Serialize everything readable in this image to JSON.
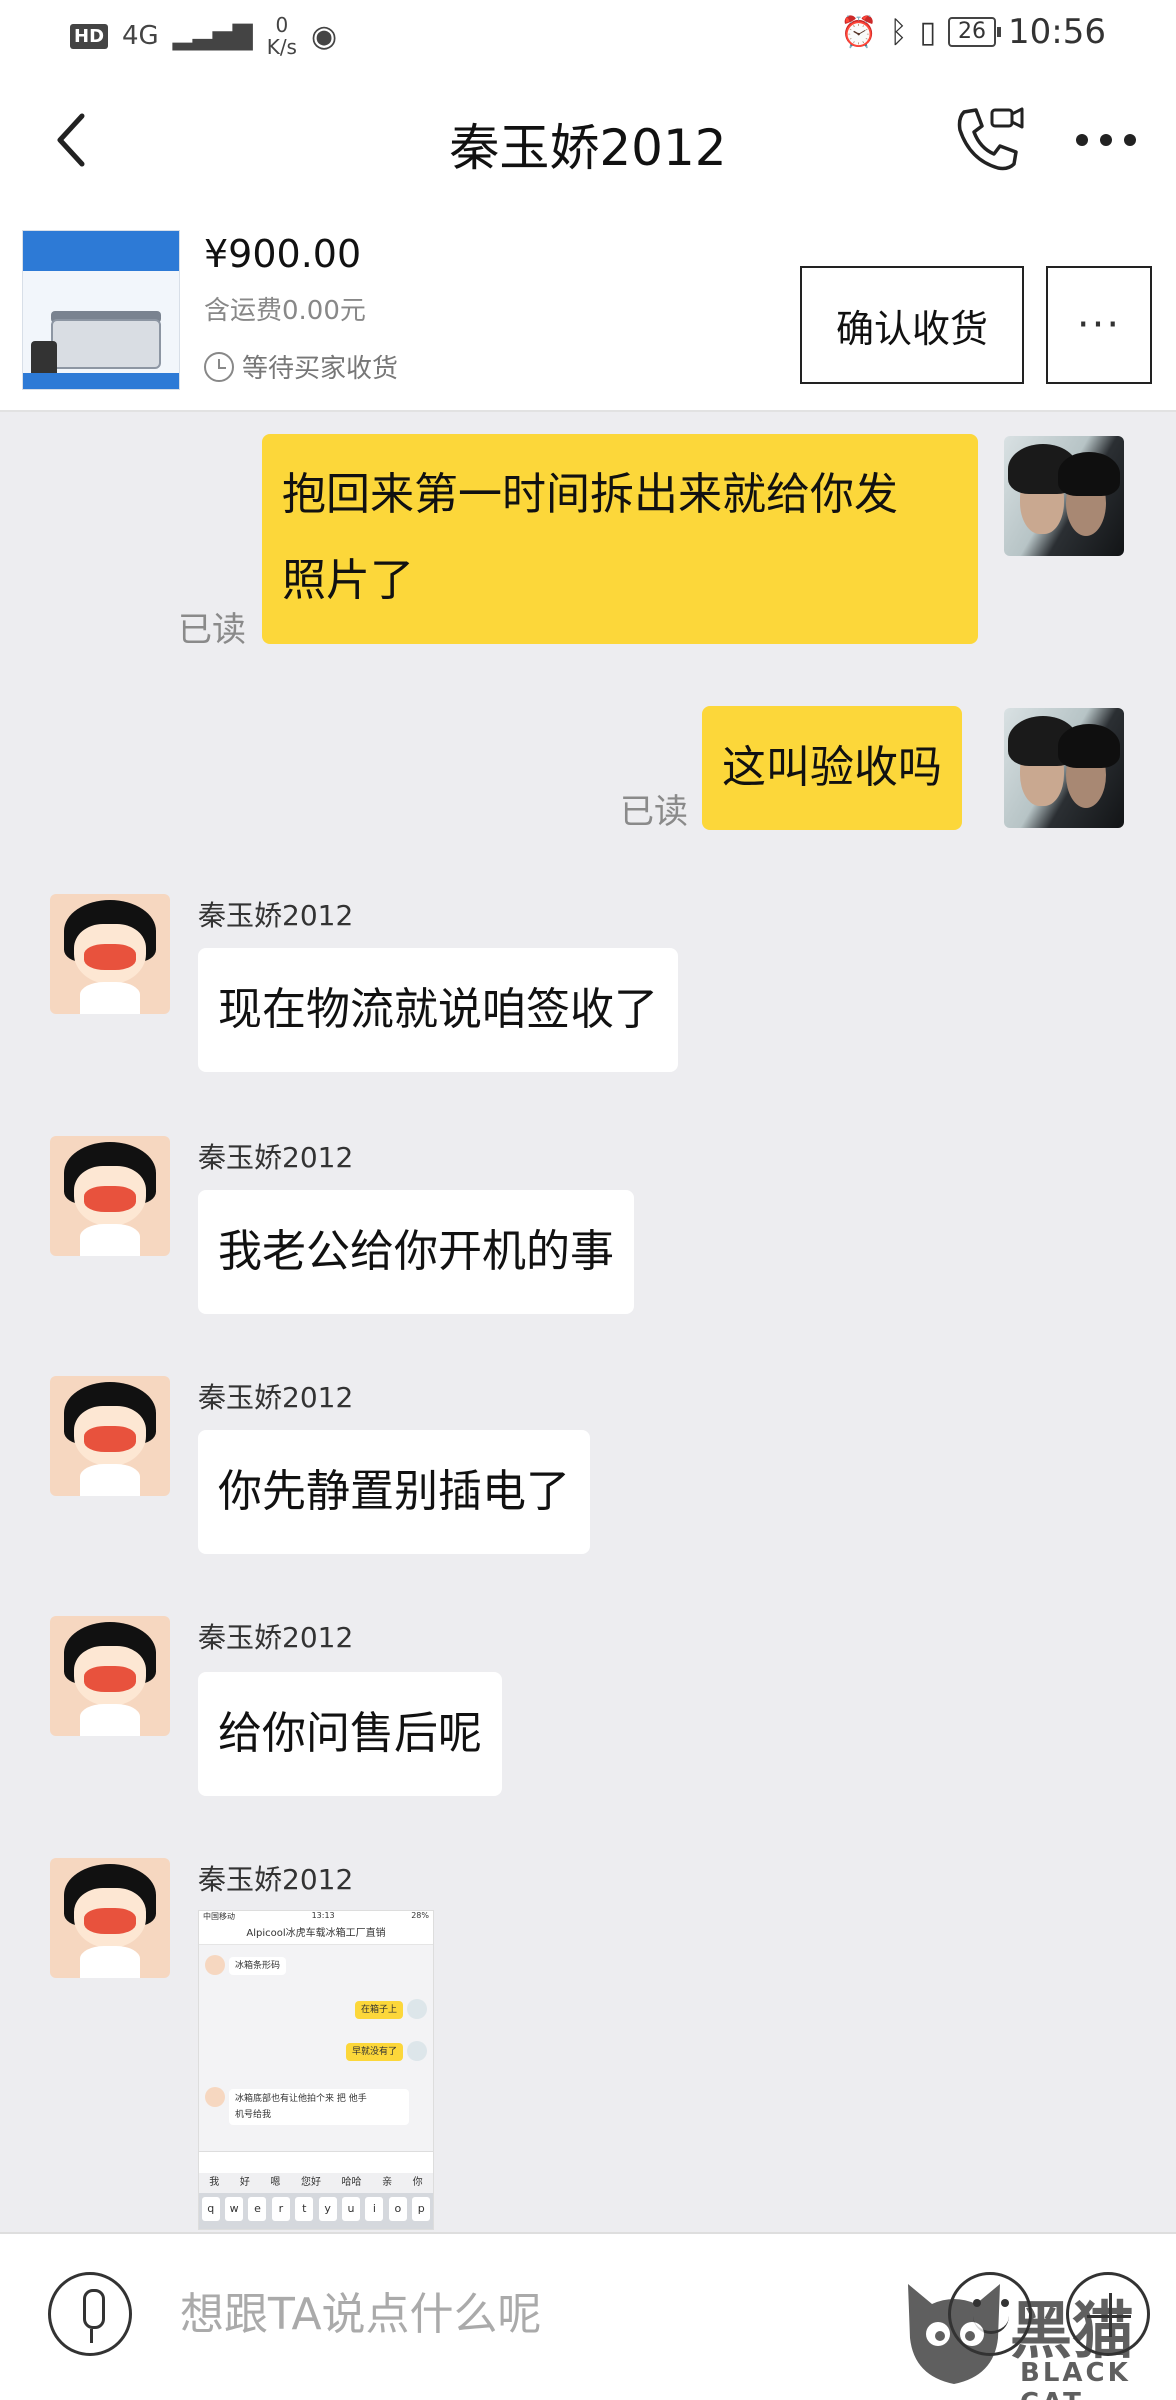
{
  "status_bar": {
    "network_badge": "HD",
    "network_type": "4G",
    "net_speed_value": "0",
    "net_speed_unit": "K/s",
    "battery": "26",
    "time": "10:56"
  },
  "header": {
    "back_icon": "chevron-left-icon",
    "title": "秦玉娇2012",
    "call_icon": "phone-video-icon",
    "more_icon": "more-dots-icon"
  },
  "order": {
    "price": "¥900.00",
    "shipping": "含运费0.00元",
    "status": "等待买家收货",
    "confirm_label": "确认收货",
    "more_label": "···"
  },
  "messages": [
    {
      "side": "me",
      "text_line1": "抱回来第一时间拆出来就给你发",
      "text_line2": "照片了",
      "read": "已读"
    },
    {
      "side": "me",
      "text": "这叫验收吗",
      "read": "已读"
    },
    {
      "side": "them",
      "sender": "秦玉娇2012",
      "text": "现在物流就说咱签收了"
    },
    {
      "side": "them",
      "sender": "秦玉娇2012",
      "text": "我老公给你开机的事"
    },
    {
      "side": "them",
      "sender": "秦玉娇2012",
      "text": "你先静置别插电了"
    },
    {
      "side": "them",
      "sender": "秦玉娇2012",
      "text": "给你问售后呢"
    },
    {
      "side": "them",
      "sender": "秦玉娇2012",
      "type": "image"
    }
  ],
  "screenshot_image": {
    "carrier": "中国移动",
    "time": "13:13",
    "battery": "28%",
    "title": "Alpicool冰虎车载冰箱工厂直销",
    "msg1": "冰箱条形码",
    "msg2": "在箱子上",
    "msg3": "早就没有了",
    "msg4_line1": "冰箱底部也有让他拍个来 把 他手",
    "msg4_line2": "机号给我",
    "candidates": [
      "我",
      "好",
      "嗯",
      "您好",
      "哈哈",
      "亲",
      "你"
    ],
    "keys": [
      "q",
      "w",
      "e",
      "r",
      "t",
      "y",
      "u",
      "i",
      "o",
      "p"
    ]
  },
  "input_bar": {
    "placeholder": "想跟TA说点什么呢",
    "mic_icon": "microphone-icon",
    "emoji_icon": "emoji-icon",
    "plus_icon": "plus-icon"
  },
  "watermark": {
    "text": "黑猫",
    "sub": "BLACK CAT"
  },
  "colors": {
    "my_bubble": "#fcd73a",
    "their_bubble": "#ffffff",
    "background": "#ededf0"
  }
}
